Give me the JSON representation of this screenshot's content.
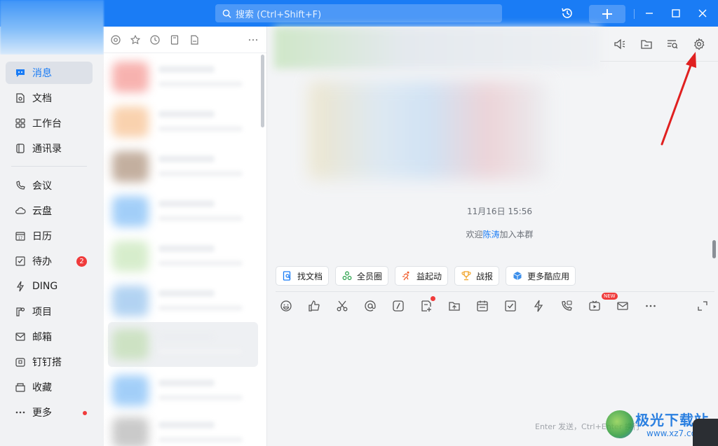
{
  "titlebar": {
    "search_placeholder": "搜索 (Ctrl+Shift+F)",
    "history_icon": "history-icon",
    "add_icon": "plus-icon"
  },
  "sidebar": {
    "items": [
      {
        "label": "消息",
        "icon": "message-icon",
        "active": true
      },
      {
        "label": "文档",
        "icon": "document-icon"
      },
      {
        "label": "工作台",
        "icon": "grid-icon"
      },
      {
        "label": "通讯录",
        "icon": "contacts-icon"
      },
      {
        "label": "会议",
        "icon": "video-call-icon"
      },
      {
        "label": "云盘",
        "icon": "cloud-icon"
      },
      {
        "label": "日历",
        "icon": "calendar-icon"
      },
      {
        "label": "待办",
        "icon": "todo-icon",
        "badge": "2"
      },
      {
        "label": "DING",
        "icon": "lightning-icon"
      },
      {
        "label": "项目",
        "icon": "project-icon"
      },
      {
        "label": "邮箱",
        "icon": "mail-icon"
      },
      {
        "label": "钉钉搭",
        "icon": "build-icon"
      },
      {
        "label": "收藏",
        "icon": "favorite-icon"
      },
      {
        "label": "更多",
        "icon": "more-icon",
        "dot": true
      }
    ]
  },
  "chat": {
    "timestamp": "11月16日 15:56",
    "system_msg_prefix": "欢迎",
    "system_msg_name": "陈涛",
    "system_msg_suffix": "加入本群",
    "quick_actions": [
      {
        "label": "找文档",
        "icon": "find-doc-icon"
      },
      {
        "label": "全员圈",
        "icon": "circle-icon"
      },
      {
        "label": "益起动",
        "icon": "run-icon"
      },
      {
        "label": "战报",
        "icon": "trophy-icon"
      },
      {
        "label": "更多酷应用",
        "icon": "cube-icon"
      }
    ],
    "new_badge": "NEW",
    "send_hint": "Enter 发送，Ctrl+Enter 换行"
  },
  "watermark": {
    "line1": "极光下载站",
    "line2": "www.xz7.com"
  },
  "colors": {
    "accent": "#1a7cf5",
    "badge": "#f03b3b"
  }
}
